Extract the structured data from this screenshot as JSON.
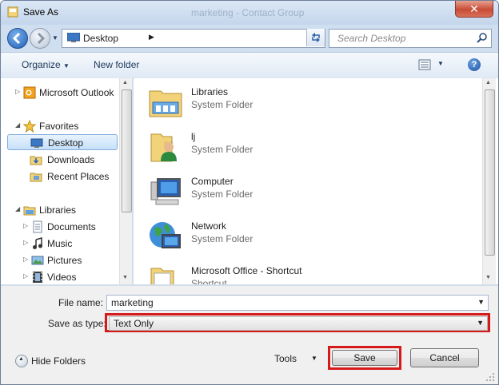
{
  "window": {
    "title": "Save As",
    "background_title": "marketing - Contact Group",
    "close_symbol": "✕"
  },
  "nav": {
    "back_label": "◀",
    "forward_label": "▶"
  },
  "address": {
    "location": "Desktop",
    "separator": "▶"
  },
  "search": {
    "placeholder": "Search Desktop"
  },
  "toolbar": {
    "organize_label": "Organize",
    "new_folder_label": "New folder",
    "help_symbol": "?"
  },
  "sidebar": {
    "items": [
      {
        "label": "Microsoft Outlook",
        "icon": "outlook-icon"
      },
      {
        "label": "Favorites",
        "icon": "star-icon"
      },
      {
        "label": "Desktop",
        "icon": "desktop-icon",
        "selected": true
      },
      {
        "label": "Downloads",
        "icon": "downloads-folder-icon"
      },
      {
        "label": "Recent Places",
        "icon": "recent-places-icon"
      },
      {
        "label": "Libraries",
        "icon": "libraries-icon"
      },
      {
        "label": "Documents",
        "icon": "documents-icon"
      },
      {
        "label": "Music",
        "icon": "music-icon"
      },
      {
        "label": "Pictures",
        "icon": "pictures-icon"
      },
      {
        "label": "Videos",
        "icon": "videos-icon"
      }
    ]
  },
  "files": {
    "items": [
      {
        "name": "Libraries",
        "type": "System Folder",
        "icon": "libraries-folder-icon"
      },
      {
        "name": "lj",
        "type": "System Folder",
        "icon": "user-folder-icon"
      },
      {
        "name": "Computer",
        "type": "System Folder",
        "icon": "computer-icon"
      },
      {
        "name": "Network",
        "type": "System Folder",
        "icon": "network-icon"
      },
      {
        "name": "Microsoft Office - Shortcut",
        "type": "Shortcut",
        "icon": "shortcut-folder-icon"
      }
    ]
  },
  "form": {
    "file_name_label": "File name:",
    "file_name_value": "marketing",
    "save_type_label": "Save as type:",
    "save_type_value": "Text Only"
  },
  "footer": {
    "hide_folders_label": "Hide Folders",
    "tools_label": "Tools",
    "save_label": "Save",
    "cancel_label": "Cancel"
  },
  "colors": {
    "highlight": "#d61a1a",
    "selection": "#c6e0f9",
    "chrome": "#cfdff0"
  }
}
